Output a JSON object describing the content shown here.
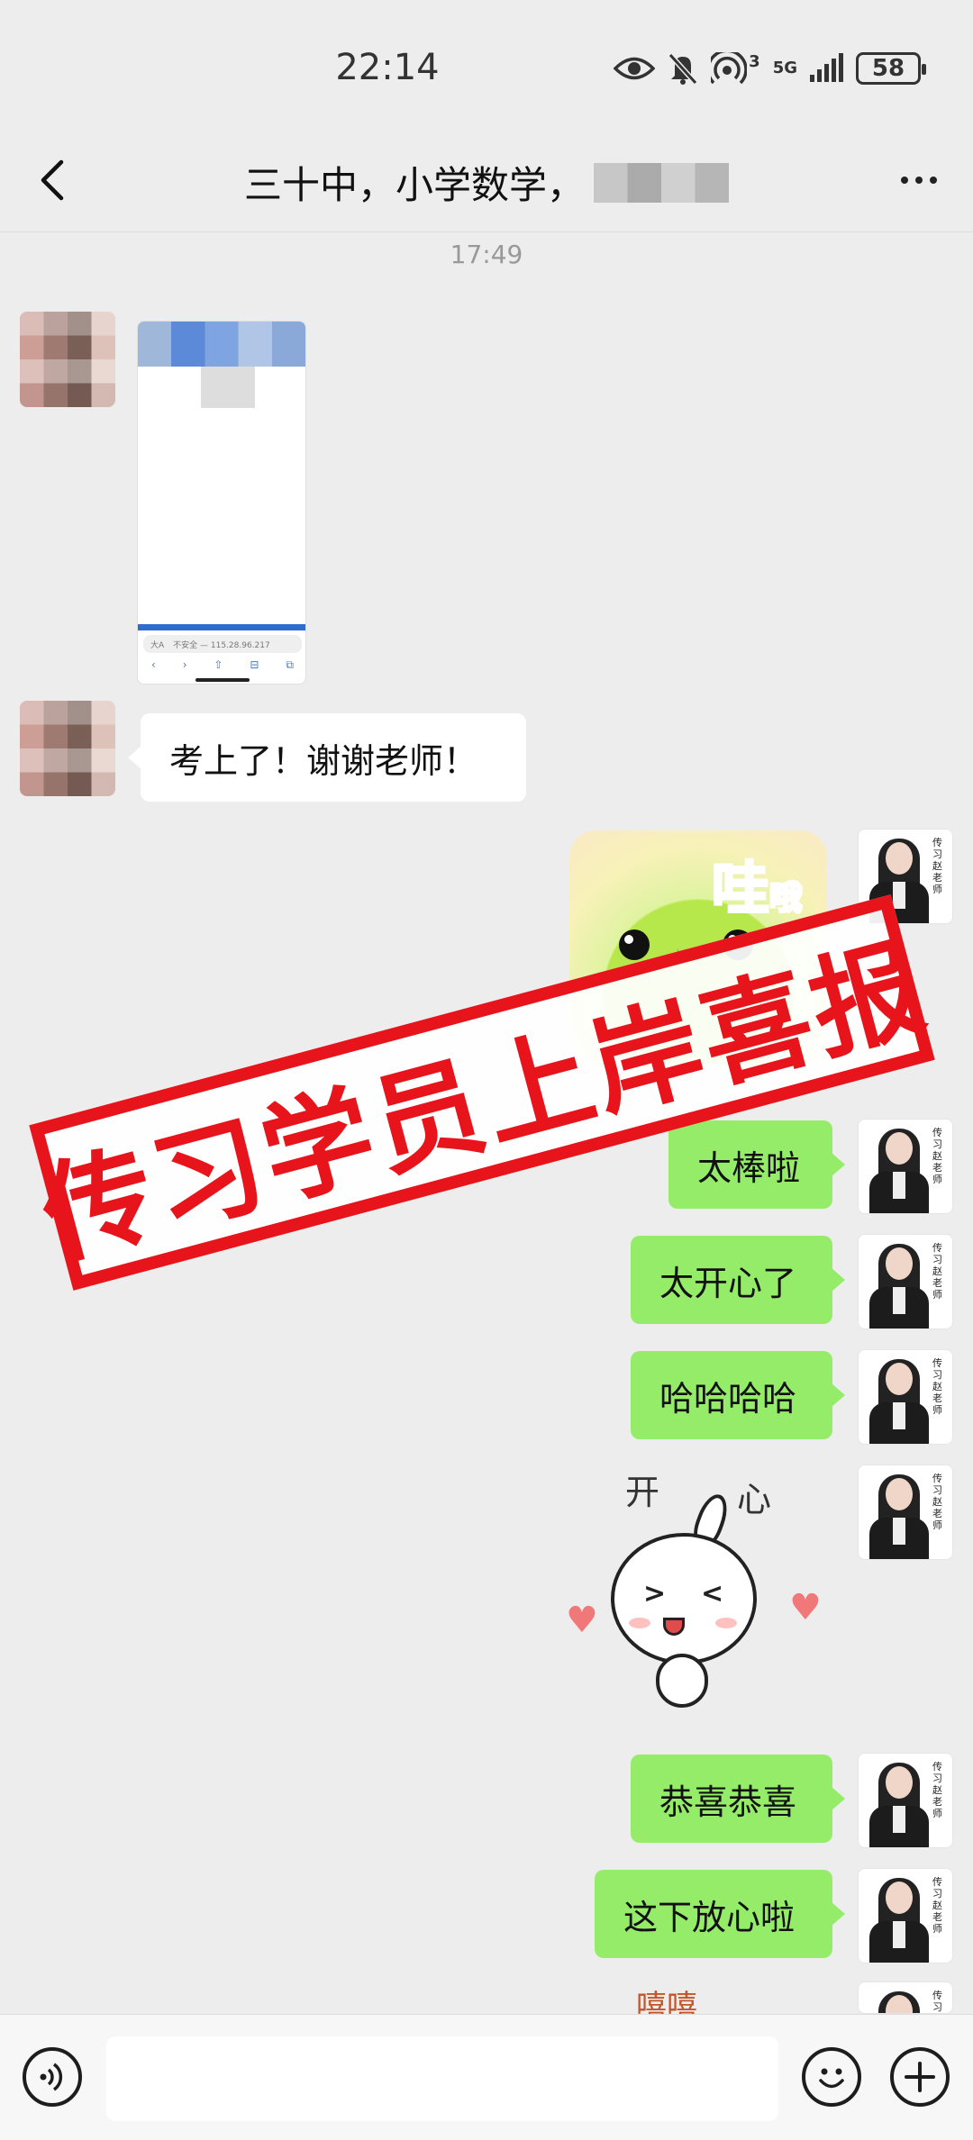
{
  "status_bar": {
    "time": "22:14",
    "network": "5G",
    "sim_slot": "3",
    "battery": "58"
  },
  "header": {
    "title": "三十中，小学数学，"
  },
  "chat": {
    "timestamp": "17:49",
    "screenshot_urlbar": "不安全 — 115.28.96.217",
    "screenshot_urlbar_prefix": "大A",
    "messages": {
      "incoming_1": "考上了！谢谢老师！",
      "outgoing_1": "太棒啦",
      "outgoing_2": "太开心了",
      "outgoing_3": "哈哈哈哈",
      "outgoing_4": "恭喜恭喜",
      "outgoing_5": "这下放心啦"
    },
    "sticker_wa": "哇",
    "sticker_wa_small": "哦",
    "sticker_kaixin_1": "开",
    "sticker_kaixin_2": "心",
    "partial_sticker_text": "嘻嘻",
    "teacher_avatar_sign": "传习赵老师"
  },
  "banner": {
    "text": "传习学员上岸喜报"
  },
  "input_bar": {
    "placeholder": ""
  }
}
